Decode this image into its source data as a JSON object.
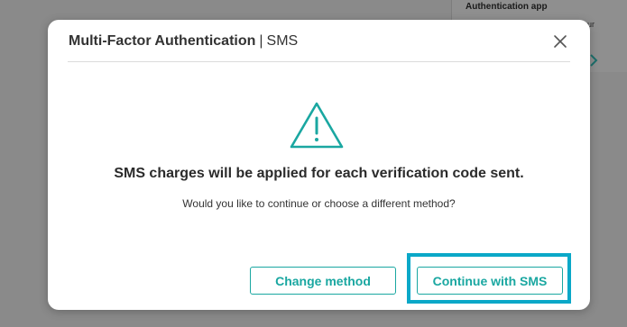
{
  "background": {
    "card_title": "Authentication app",
    "card_snippet": "ur",
    "arrow_icon": "chevron-right-icon"
  },
  "modal": {
    "title": "Multi-Factor Authentication",
    "separator": "|",
    "subtitle": "SMS",
    "close_icon": "close-icon",
    "warning_icon": "warning-triangle-icon",
    "message": "SMS charges will be applied for each verification code sent.",
    "question": "Would you like to continue or choose a different method?",
    "buttons": {
      "change_method": "Change method",
      "continue_sms": "Continue with SMS"
    }
  },
  "colors": {
    "accent": "#1aa7a1",
    "highlight": "#0aa8c8",
    "overlay": "#8a8a8a"
  }
}
